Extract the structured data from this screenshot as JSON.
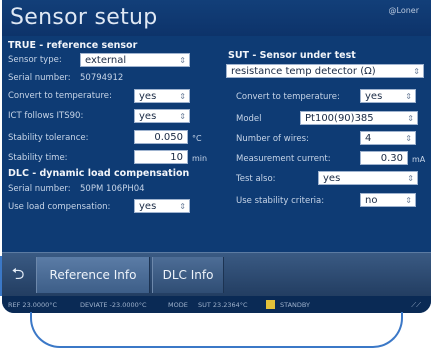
{
  "window": {
    "title": "Sensor setup",
    "logo": "@Loner"
  },
  "ref": {
    "heading": "TRUE - reference sensor",
    "sensor_type_label": "Sensor type:",
    "sensor_type_value": "external",
    "serial_label": "Serial number:",
    "serial_value": "50794912",
    "convert_label": "Convert to temperature:",
    "convert_value": "yes",
    "its_label": "ICT follows ITS90:",
    "its_value": "yes",
    "stability_label": "Stability tolerance:",
    "stability_value": "0.050",
    "stability_unit": "°C",
    "stab_time_label": "Stability time:",
    "stab_time_value": "10",
    "stab_time_unit": "min"
  },
  "dlc": {
    "heading": "DLC - dynamic load compensation",
    "serial_label": "Serial number:",
    "serial_value": "50PM 106PH04",
    "use_label": "Use load compensation:",
    "use_value": "yes"
  },
  "sut": {
    "heading": "SUT - Sensor under test",
    "type_value": "resistance temp detector (Ω)",
    "convert_label": "Convert to temperature:",
    "convert_value": "yes",
    "model_label": "Model",
    "model_value": "Pt100(90)385",
    "wires_label": "Number of wires:",
    "wires_value": "4",
    "current_label": "Measurement current:",
    "current_value": "0.30",
    "current_unit": "mA",
    "test_label": "Test also:",
    "test_value": "yes",
    "stab_label": "Use stability criteria:",
    "stab_value": "no"
  },
  "tabs": {
    "reference": "Reference Info",
    "dlc": "DLC Info"
  },
  "status": {
    "a": "REF  23.0000°C",
    "b": "DEVIATE  -23.0000°C",
    "c": "MODE",
    "d": "SUT  23.2364°C",
    "e": "STANDBY"
  }
}
